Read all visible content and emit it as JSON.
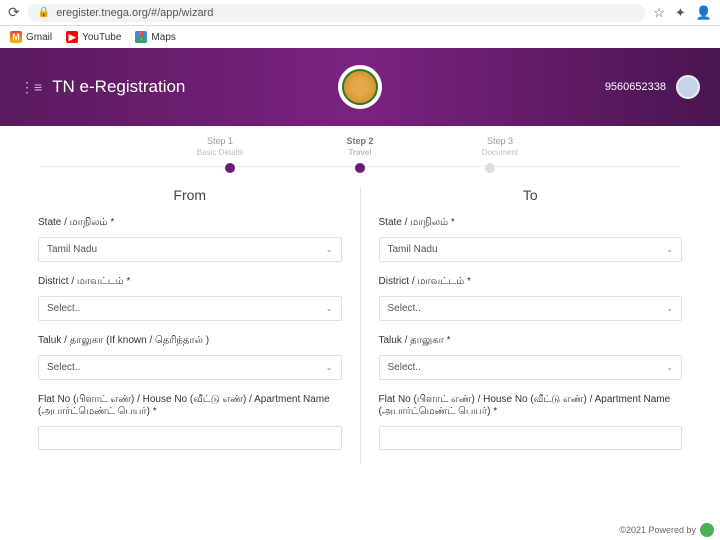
{
  "browser": {
    "url": "eregister.tnega.org/#/app/wizard"
  },
  "bookmarks": {
    "gmail": "Gmail",
    "youtube": "YouTube",
    "maps": "Maps"
  },
  "header": {
    "title": "TN e-Registration",
    "user_id": "9560652338"
  },
  "stepper": {
    "step1": {
      "label": "Step 1",
      "sub": "Basic Details"
    },
    "step2": {
      "label": "Step 2",
      "sub": "Travel"
    },
    "step3": {
      "label": "Step 3",
      "sub": "Document"
    }
  },
  "form": {
    "from": {
      "title": "From",
      "state_label": "State / மாநிலம் *",
      "state_value": "Tamil Nadu",
      "district_label": "District / மாவட்டம் *",
      "district_value": "Select..",
      "taluk_label": "Taluk / தாலுகா (If known / தெரிந்தால் )",
      "taluk_value": "Select..",
      "flat_label": "Flat No (பிளாட் எண்) / House No (வீட்டு எண்) / Apartment Name (அபார்ட்மெண்ட் பெயர்) *"
    },
    "to": {
      "title": "To",
      "state_label": "State / மாநிலம் *",
      "state_value": "Tamil Nadu",
      "district_label": "District / மாவட்டம் *",
      "district_value": "Select..",
      "taluk_label": "Taluk / தாலுகா *",
      "taluk_value": "Select..",
      "flat_label": "Flat No (பிளாட் எண்) / House No (வீட்டு எண்) / Apartment Name (அபார்ட்மெண்ட் பெயர்) *"
    }
  },
  "footer": {
    "text": "©2021 Powered by"
  }
}
